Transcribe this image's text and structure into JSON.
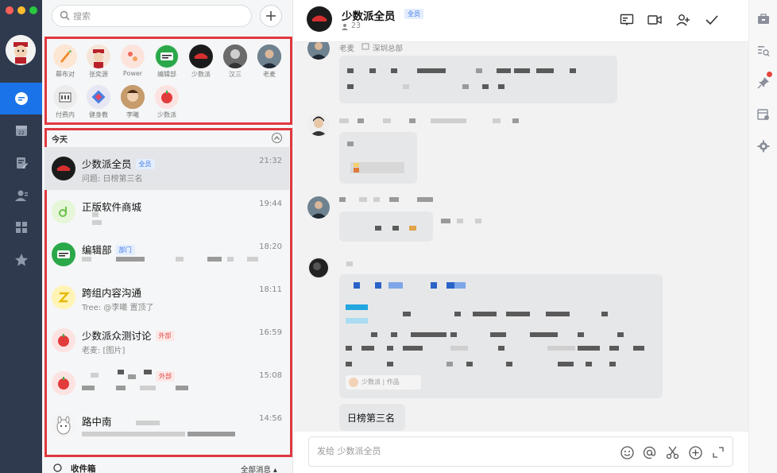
{
  "window": {
    "traffic_colors": [
      "#fe5f57",
      "#febc2e",
      "#28c840"
    ]
  },
  "rail": {
    "items": [
      "chat-bubble",
      "calendar",
      "document-edit",
      "contacts",
      "apps-grid",
      "star"
    ],
    "active": "chat-bubble"
  },
  "search": {
    "placeholder": "搜索"
  },
  "favorites": [
    {
      "name": "幕布对",
      "color": "#fde6d3"
    },
    {
      "name": "张奕源",
      "color": "#f5e5d8"
    },
    {
      "name": "Power",
      "color": "#fce4dd"
    },
    {
      "name": "编辑部",
      "color": "#d9f0e0"
    },
    {
      "name": "少数派",
      "color": "#222222"
    },
    {
      "name": "汉三",
      "color": "#555555"
    },
    {
      "name": "老麦",
      "color": "#3a4a5a"
    },
    {
      "name": "付费内",
      "color": "#ececec"
    },
    {
      "name": "健身教",
      "color": "#e7e7f4"
    },
    {
      "name": "李曦",
      "color": "#b58a5e"
    },
    {
      "name": "少数派",
      "color": "#fde2e2"
    }
  ],
  "section": {
    "today_label": "今天"
  },
  "conversations": [
    {
      "title": "少数派全员",
      "tag": "全员",
      "tag_style": "blue",
      "subtitle": "问题: 日榜第三名",
      "time": "21:32"
    },
    {
      "title": "正版软件商城",
      "tag": "",
      "tag_style": "",
      "subtitle": "",
      "time": "19:44"
    },
    {
      "title": "编辑部",
      "tag": "部门",
      "tag_style": "blue",
      "subtitle": "",
      "time": "18:20"
    },
    {
      "title": "跨组内容沟通",
      "tag": "",
      "tag_style": "",
      "subtitle": "Tree: @李曦 置顶了",
      "time": "18:11"
    },
    {
      "title": "少数派众测讨论",
      "tag": "外部",
      "tag_style": "red",
      "subtitle": "老麦: [图片]",
      "time": "16:59"
    },
    {
      "title": "",
      "tag": "外部",
      "tag_style": "red",
      "subtitle": "",
      "time": "15:08"
    },
    {
      "title": "路中南",
      "tag": "",
      "tag_style": "",
      "subtitle": "",
      "time": "14:56"
    }
  ],
  "inbox": {
    "label": "收件箱",
    "filter": "全部消息 ▴"
  },
  "chat": {
    "title": "少数派全员",
    "tag": "全员",
    "members": "23",
    "msg1_sender": "老麦",
    "msg1_dept": "深圳总部",
    "last_message": "日榜第三名",
    "quote_label": "少数派 | 作品",
    "composer_placeholder": "发给 少数派全员"
  },
  "accent": "#1a73e8",
  "highlight": "#e0383f"
}
